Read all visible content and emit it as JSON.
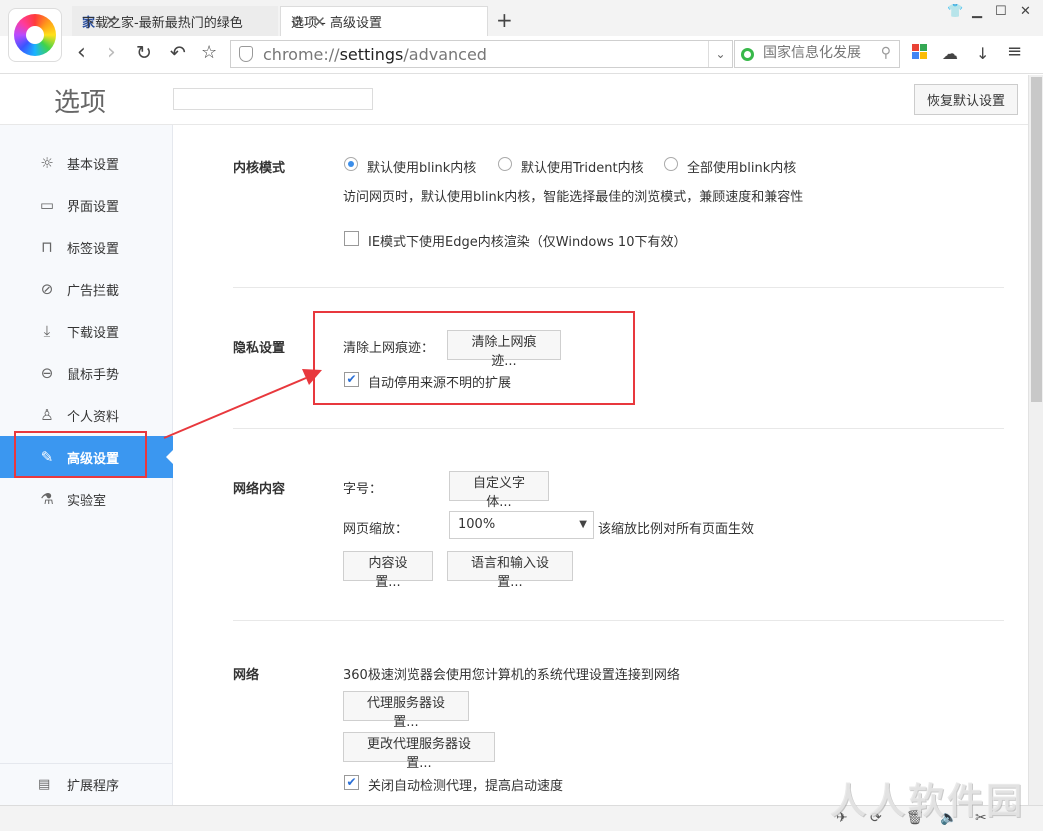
{
  "browser": {
    "tabs": [
      {
        "icon": "家",
        "title": "下载之家-最新最热门的绿色",
        "close": "✕"
      },
      {
        "icon": "gear-icon",
        "title": "选项 - 高级设置",
        "close": "✕"
      }
    ],
    "new_tab": "+",
    "address": {
      "scheme": "chrome://",
      "host": "settings",
      "path": "/advanced"
    },
    "search": {
      "placeholder": "国家信息化发展"
    }
  },
  "settings": {
    "title": "选项",
    "restore_label": "恢复默认设置",
    "sidebar": [
      {
        "label": "基本设置",
        "icon": "sun-gear-icon"
      },
      {
        "label": "界面设置",
        "icon": "window-icon"
      },
      {
        "label": "标签设置",
        "icon": "tab-icon"
      },
      {
        "label": "广告拦截",
        "icon": "block-icon"
      },
      {
        "label": "下载设置",
        "icon": "download-icon"
      },
      {
        "label": "鼠标手势",
        "icon": "mouse-icon"
      },
      {
        "label": "个人资料",
        "icon": "person-icon"
      },
      {
        "label": "高级设置",
        "icon": "wrench-icon",
        "active": true
      },
      {
        "label": "实验室",
        "icon": "flask-icon"
      }
    ],
    "sidebar_bottom": {
      "label": "扩展程序",
      "icon": "extension-icon"
    },
    "kernel": {
      "label": "内核模式",
      "options": [
        "默认使用blink内核",
        "默认使用Trident内核",
        "全部使用blink内核"
      ],
      "selected": 0,
      "desc": "访问网页时，默认使用blink内核，智能选择最佳的浏览模式，兼顾速度和兼容性",
      "ie_edge": {
        "label": "IE模式下使用Edge内核渲染（仅Windows 10下有效）",
        "checked": false
      }
    },
    "privacy": {
      "label": "隐私设置",
      "clear_label": "清除上网痕迹：",
      "clear_button": "清除上网痕迹...",
      "auto_disable": {
        "label": "自动停用来源不明的扩展",
        "checked": true
      }
    },
    "web_content": {
      "label": "网络内容",
      "font_label": "字号：",
      "font_button": "自定义字体...",
      "zoom_label": "网页缩放：",
      "zoom_value": "100%",
      "zoom_note": "该缩放比例对所有页面生效",
      "content_button": "内容设置...",
      "lang_button": "语言和输入设置..."
    },
    "network": {
      "label": "网络",
      "desc": "360极速浏览器会使用您计算机的系统代理设置连接到网络",
      "proxy_button": "代理服务器设置...",
      "change_proxy_button": "更改代理服务器设置...",
      "auto_detect": {
        "label": "关闭自动检测代理，提高启动速度",
        "checked": true
      }
    }
  },
  "watermark": "人人软件园",
  "annotation_color": "#e8383d"
}
